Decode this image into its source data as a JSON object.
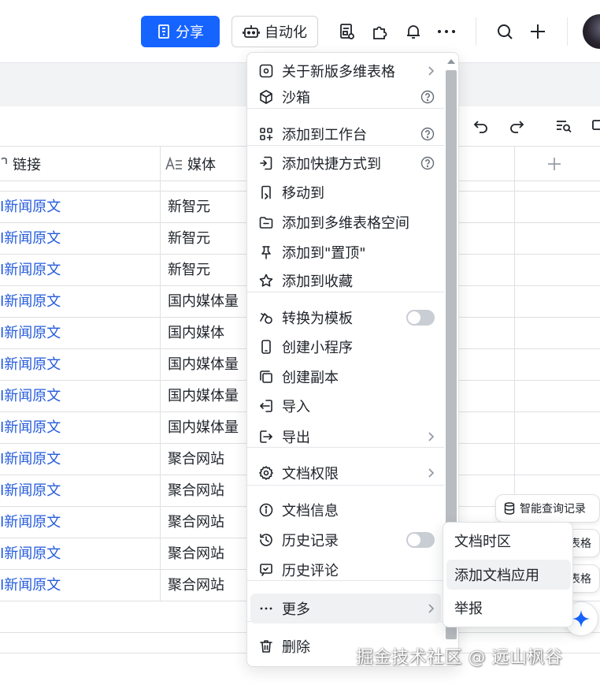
{
  "topbar": {
    "share_label": "分享",
    "automation_label": "自动化"
  },
  "grid": {
    "columns": [
      {
        "label": "链接",
        "icon": "link-icon"
      },
      {
        "label": "媒体",
        "icon": "text-field-icon"
      }
    ],
    "rows": [
      {
        "link": "I新闻原文",
        "media": "新智元"
      },
      {
        "link": "I新闻原文",
        "media": "新智元"
      },
      {
        "link": "I新闻原文",
        "media": "新智元"
      },
      {
        "link": "I新闻原文",
        "media": "国内媒体量"
      },
      {
        "link": "I新闻原文",
        "media": "国内媒体"
      },
      {
        "link": "I新闻原文",
        "media": "国内媒体量"
      },
      {
        "link": "I新闻原文",
        "media": "国内媒体量"
      },
      {
        "link": "I新闻原文",
        "media": "国内媒体量"
      },
      {
        "link": "I新闻原文",
        "media": "聚合网站"
      },
      {
        "link": "I新闻原文",
        "media": "聚合网站"
      },
      {
        "link": "I新闻原文",
        "media": "聚合网站"
      },
      {
        "link": "I新闻原文",
        "media": "聚合网站"
      },
      {
        "link": "I新闻原文",
        "media": "聚合网站"
      }
    ]
  },
  "menu": {
    "items": [
      {
        "label": "关于新版多维表格",
        "icon": "info-frame-icon",
        "right": "chevron"
      },
      {
        "label": "沙箱",
        "icon": "cube-icon",
        "right": "help"
      },
      {
        "label": "添加到工作台",
        "icon": "apps-add-icon",
        "right": "help"
      },
      {
        "label": "添加快捷方式到",
        "icon": "shortcut-icon",
        "right": "help"
      },
      {
        "label": "移动到",
        "icon": "move-icon",
        "right": ""
      },
      {
        "label": "添加到多维表格空间",
        "icon": "folder-add-icon",
        "right": ""
      },
      {
        "label": "添加到\"置顶\"",
        "icon": "pin-icon",
        "right": ""
      },
      {
        "label": "添加到收藏",
        "icon": "star-icon",
        "right": ""
      },
      {
        "label": "转换为模板",
        "icon": "template-icon",
        "right": "toggle"
      },
      {
        "label": "创建小程序",
        "icon": "mobile-icon",
        "right": ""
      },
      {
        "label": "创建副本",
        "icon": "copy-icon",
        "right": ""
      },
      {
        "label": "导入",
        "icon": "import-icon",
        "right": ""
      },
      {
        "label": "导出",
        "icon": "export-icon",
        "right": "chevron"
      },
      {
        "label": "文档权限",
        "icon": "gear-icon",
        "right": "chevron"
      },
      {
        "label": "文档信息",
        "icon": "info-icon",
        "right": ""
      },
      {
        "label": "历史记录",
        "icon": "history-icon",
        "right": "toggle"
      },
      {
        "label": "历史评论",
        "icon": "comment-icon",
        "right": ""
      },
      {
        "label": "更多",
        "icon": "more-icon",
        "right": "chevron"
      },
      {
        "label": "删除",
        "icon": "trash-icon",
        "right": ""
      }
    ]
  },
  "submenu": {
    "items": [
      {
        "label": "文档时区"
      },
      {
        "label": "添加文档应用"
      },
      {
        "label": "举报"
      }
    ]
  },
  "floating": {
    "smart_query_label": "智能查询记录",
    "pill2_label": "表格",
    "pill3_label": "表格"
  },
  "watermark": "掘金技术社区 @ 远山枫谷",
  "colors": {
    "accent": "#1664ff",
    "link": "#245bdb",
    "text": "#1f2329",
    "border": "#dee0e3",
    "hover": "#f0f1f2"
  }
}
